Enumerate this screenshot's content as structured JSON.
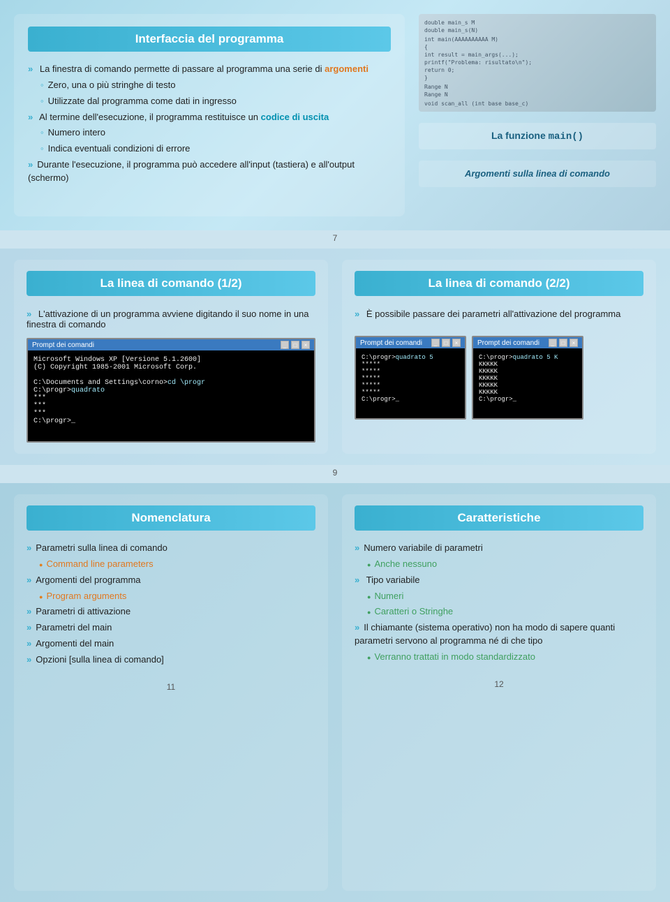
{
  "top": {
    "left": {
      "title": "Interfaccia del programma",
      "bullets": [
        {
          "type": "main",
          "text": "La finestra di comando permette di passare al programma una serie di ",
          "highlight": "argomenti",
          "highlight_type": "orange"
        },
        {
          "type": "sub",
          "text": "Zero, una o più stringhe di testo"
        },
        {
          "type": "sub",
          "text": "Utilizzate dal programma come dati in ingresso"
        },
        {
          "type": "main",
          "text": "Al termine dell'esecuzione, il programma restituisce un ",
          "highlight": "codice di uscita",
          "highlight_type": "cyan"
        },
        {
          "type": "sub",
          "text": "Numero intero"
        },
        {
          "type": "sub",
          "text": "Indica eventuali condizioni di errore"
        },
        {
          "type": "main",
          "text": "Durante l'esecuzione, il programma può accedere all'input (tastiera) e all'output (schermo)"
        }
      ]
    },
    "right": {
      "funzione_label": "La funzione ",
      "funzione_code": "main()",
      "argomenti_label": "Argomenti sulla linea di comando"
    },
    "page_num": "7"
  },
  "middle": {
    "left": {
      "title": "La linea di comando (1/2)",
      "bullets": [
        {
          "text": "L'attivazione di un programma avviene digitando il suo nome in una finestra di comando"
        }
      ],
      "terminal": {
        "title": "Prompt dei comandi",
        "lines": [
          "Microsoft Windows XP [Versione 5.1.2600]",
          "(C) Copyright 1985-2001 Microsoft Corp.",
          "",
          "C:\\Documents and Settings\\corno>cd \\progr",
          "C:\\progr>quadrato",
          "***",
          "***",
          "***",
          "C:\\progr>_"
        ],
        "highlight_line": "C:\\progr>quadrato"
      }
    },
    "right": {
      "title": "La linea di comando (2/2)",
      "bullets": [
        {
          "text": "È possibile passare dei parametri all'attivazione del programma"
        }
      ],
      "terminals": [
        {
          "title": "Prompt dei comandi",
          "lines": [
            "C:\\progr>quadrato 5",
            "*****",
            "*****",
            "*****",
            "*****",
            "*****",
            "C:\\progr>_"
          ],
          "highlight": "quadrato 5"
        },
        {
          "title": "Prompt dei comandi",
          "lines": [
            "C:\\progr>quadrato 5 K",
            "KKKKK",
            "KKKKK",
            "KKKKK",
            "KKKKK",
            "KKKKK",
            "C:\\progr>_"
          ],
          "highlight": "quadrato 5 K"
        }
      ]
    },
    "page_num": "9"
  },
  "bottom": {
    "left": {
      "title": "Nomenclatura",
      "items": [
        {
          "type": "main",
          "text": "Parametri sulla linea di comando"
        },
        {
          "type": "sub_orange",
          "text": "Command line parameters"
        },
        {
          "type": "main",
          "text": "Argomenti del programma"
        },
        {
          "type": "sub_orange",
          "text": "Program arguments"
        },
        {
          "type": "main",
          "text": "Parametri di attivazione"
        },
        {
          "type": "main",
          "text": "Parametri del main"
        },
        {
          "type": "main",
          "text": "Argomenti del main"
        },
        {
          "type": "main",
          "text": "Opzioni [sulla linea di comando]"
        }
      ]
    },
    "right": {
      "title": "Caratteristiche",
      "items": [
        {
          "type": "main",
          "text": "Numero variabile di parametri"
        },
        {
          "type": "sub_green",
          "text": "Anche nessuno"
        },
        {
          "type": "main_arrow",
          "text": "Tipo variabile"
        },
        {
          "type": "sub_green",
          "text": "Numeri"
        },
        {
          "type": "sub_green",
          "text": "Caratteri o Stringhe"
        },
        {
          "type": "main",
          "text": "Il chiamante (sistema operativo) non ha modo di sapere quanti parametri servono al programma né di che tipo"
        },
        {
          "type": "sub_green",
          "text": "Verranno trattati in modo standardizzato"
        }
      ]
    },
    "page_num_left": "11",
    "page_num_right": "12"
  }
}
